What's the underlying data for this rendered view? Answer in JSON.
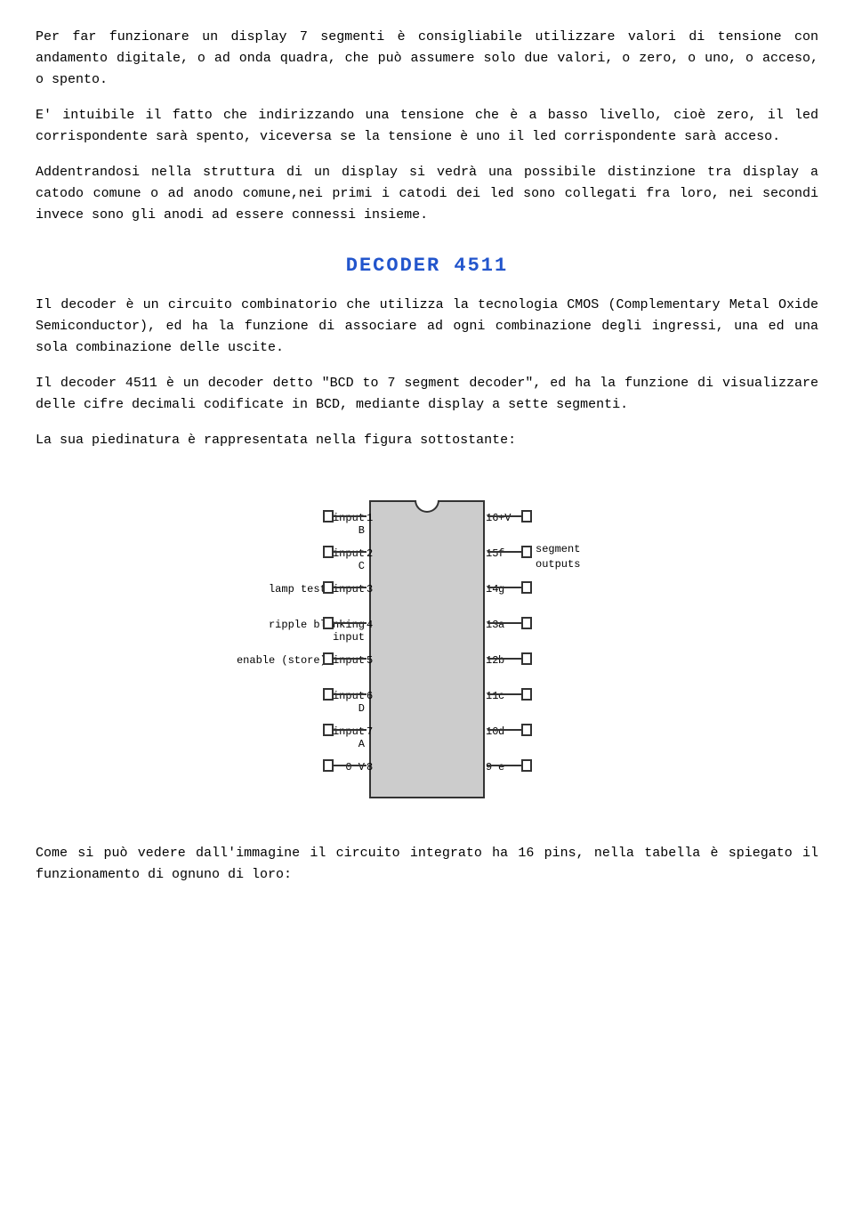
{
  "intro": {
    "p1": "Per far funzionare un display 7 segmenti è consigliabile utilizzare valori di tensione con andamento digitale, o ad onda quadra, che può assumere solo due valori, o zero, o uno, o acceso, o spento.",
    "p2": "E' intuibile il fatto che indirizzando una tensione che è a basso livello, cioè zero, il led corrispondente sarà spento, viceversa se la tensione è uno il led corrispondente sarà acceso.",
    "p3": "Addentrandosi nella struttura di un display si vedrà una possibile distinzione tra display a catodo comune o ad anodo comune,nei primi i catodi dei led sono collegati fra loro, nei secondi invece sono gli anodi ad essere connessi insieme."
  },
  "decoder_section": {
    "title": "DECODER 4511",
    "p1": "Il decoder è un circuito combinatorio che utilizza la tecnologia CMOS (Complementary Metal Oxide Semiconductor), ed ha la funzione di associare ad ogni combinazione degli ingressi, una ed una sola combinazione delle uscite.",
    "p2": "Il decoder 4511 è un decoder detto \"BCD to 7 segment decoder\", ed ha la funzione di visualizzare delle cifre decimali codificate in BCD, mediante display a sette segmenti.",
    "p3": "La sua piedinatura è rappresentata nella figura sottostante:"
  },
  "diagram": {
    "left_pins": [
      {
        "label": "input B",
        "number": "1"
      },
      {
        "label": "input C",
        "number": "2"
      },
      {
        "label": "lamp test input",
        "number": "3"
      },
      {
        "label": "ripple blanking input",
        "number": "4"
      },
      {
        "label": "enable (store) input",
        "number": "5"
      },
      {
        "label": "input D",
        "number": "6"
      },
      {
        "label": "input A",
        "number": "7"
      },
      {
        "label": "0 V",
        "number": "8"
      }
    ],
    "right_pins": [
      {
        "label": "+V",
        "number": "16"
      },
      {
        "label": "f",
        "number": "15"
      },
      {
        "label": "g",
        "number": "14"
      },
      {
        "label": "a",
        "number": "13"
      },
      {
        "label": "b",
        "number": "12"
      },
      {
        "label": "c",
        "number": "11"
      },
      {
        "label": "d",
        "number": "10"
      },
      {
        "label": "e",
        "number": "9"
      }
    ],
    "segment_outputs_label": "segment\noutputs"
  },
  "conclusion": {
    "p1": "Come si può vedere dall'immagine il circuito integrato ha 16 pins, nella tabella è spiegato il funzionamento di ognuno di loro:"
  }
}
